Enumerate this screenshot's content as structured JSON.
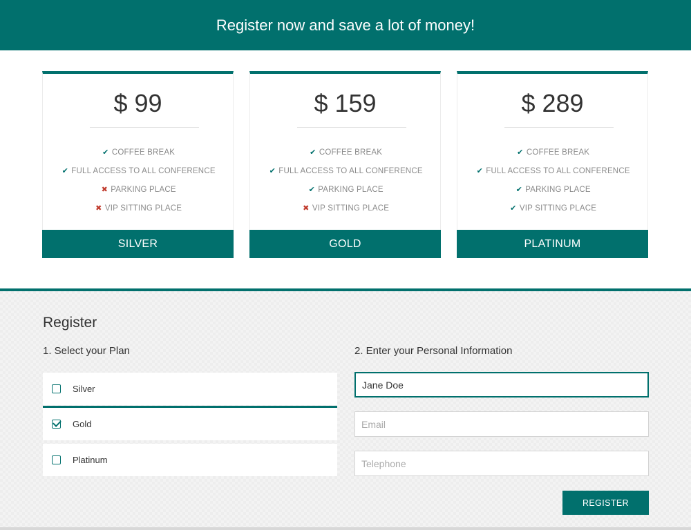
{
  "banner": {
    "text": "Register now and save a lot of money!"
  },
  "plans": [
    {
      "price": "$ 99",
      "button_label": "SILVER",
      "features": [
        {
          "label": "COFFEE BREAK",
          "included": true,
          "icon": "check-icon"
        },
        {
          "label": "FULL ACCESS TO ALL CONFERENCE",
          "included": true,
          "icon": "check-icon"
        },
        {
          "label": "PARKING PLACE",
          "included": false,
          "icon": "cross-icon"
        },
        {
          "label": "VIP SITTING PLACE",
          "included": false,
          "icon": "cross-icon"
        }
      ]
    },
    {
      "price": "$ 159",
      "button_label": "GOLD",
      "features": [
        {
          "label": "COFFEE BREAK",
          "included": true,
          "icon": "check-icon"
        },
        {
          "label": "FULL ACCESS TO ALL CONFERENCE",
          "included": true,
          "icon": "check-icon"
        },
        {
          "label": "PARKING PLACE",
          "included": true,
          "icon": "check-icon"
        },
        {
          "label": "VIP SITTING PLACE",
          "included": false,
          "icon": "cross-icon"
        }
      ]
    },
    {
      "price": "$ 289",
      "button_label": "PLATINUM",
      "features": [
        {
          "label": "COFFEE BREAK",
          "included": true,
          "icon": "check-icon"
        },
        {
          "label": "FULL ACCESS TO ALL CONFERENCE",
          "included": true,
          "icon": "check-icon"
        },
        {
          "label": "PARKING PLACE",
          "included": true,
          "icon": "check-icon"
        },
        {
          "label": "VIP SITTING PLACE",
          "included": true,
          "icon": "check-icon"
        }
      ]
    }
  ],
  "register": {
    "title": "Register",
    "step1_label": "1. Select your Plan",
    "step2_label": "2. Enter your Personal Information",
    "options": [
      {
        "label": "Silver",
        "checked": false
      },
      {
        "label": "Gold",
        "checked": true
      },
      {
        "label": "Platinum",
        "checked": false
      }
    ],
    "fields": {
      "name_value": "Jane Doe",
      "email_placeholder": "Email",
      "telephone_placeholder": "Telephone"
    },
    "submit_label": "REGISTER"
  },
  "colors": {
    "accent": "#01706d",
    "included": "#01706d",
    "excluded": "#c0392b"
  }
}
